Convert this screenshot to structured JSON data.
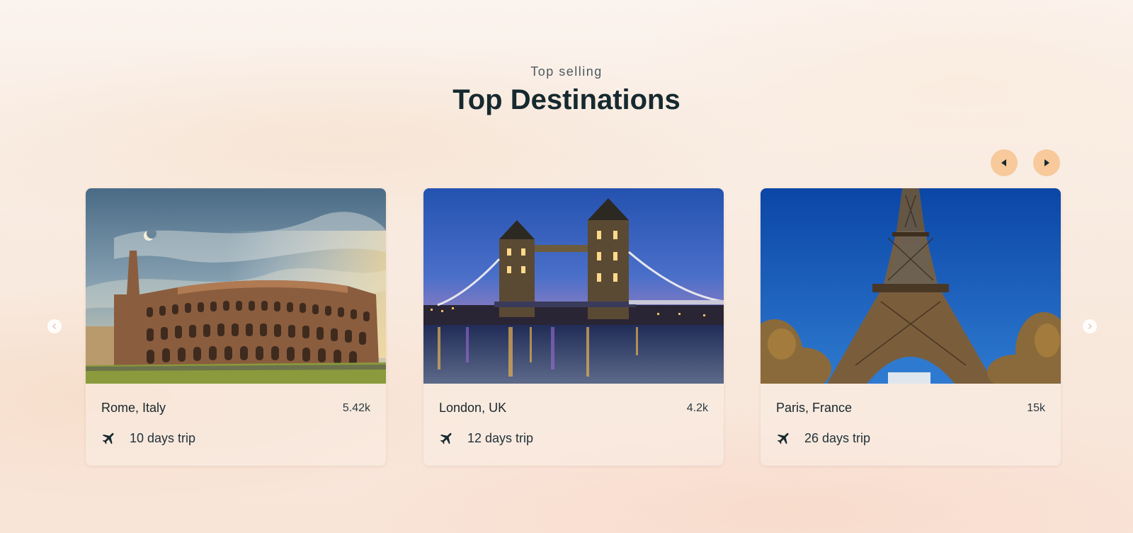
{
  "header": {
    "subtitle": "Top selling",
    "title": "Top Destinations"
  },
  "carousel": {
    "prev_icon": "caret-left-icon",
    "next_icon": "caret-right-icon",
    "accent_color": "#f7c99b"
  },
  "destinations": [
    {
      "name": "Rome, Italy",
      "count": "5.42k",
      "trip": "10 days trip",
      "image": "colosseum-photo",
      "icon": "airplane-icon"
    },
    {
      "name": "London, UK",
      "count": "4.2k",
      "trip": "12 days trip",
      "image": "tower-bridge-photo",
      "icon": "airplane-icon"
    },
    {
      "name": "Paris, France",
      "count": "15k",
      "trip": "26 days trip",
      "image": "eiffel-tower-photo",
      "icon": "airplane-icon"
    }
  ]
}
